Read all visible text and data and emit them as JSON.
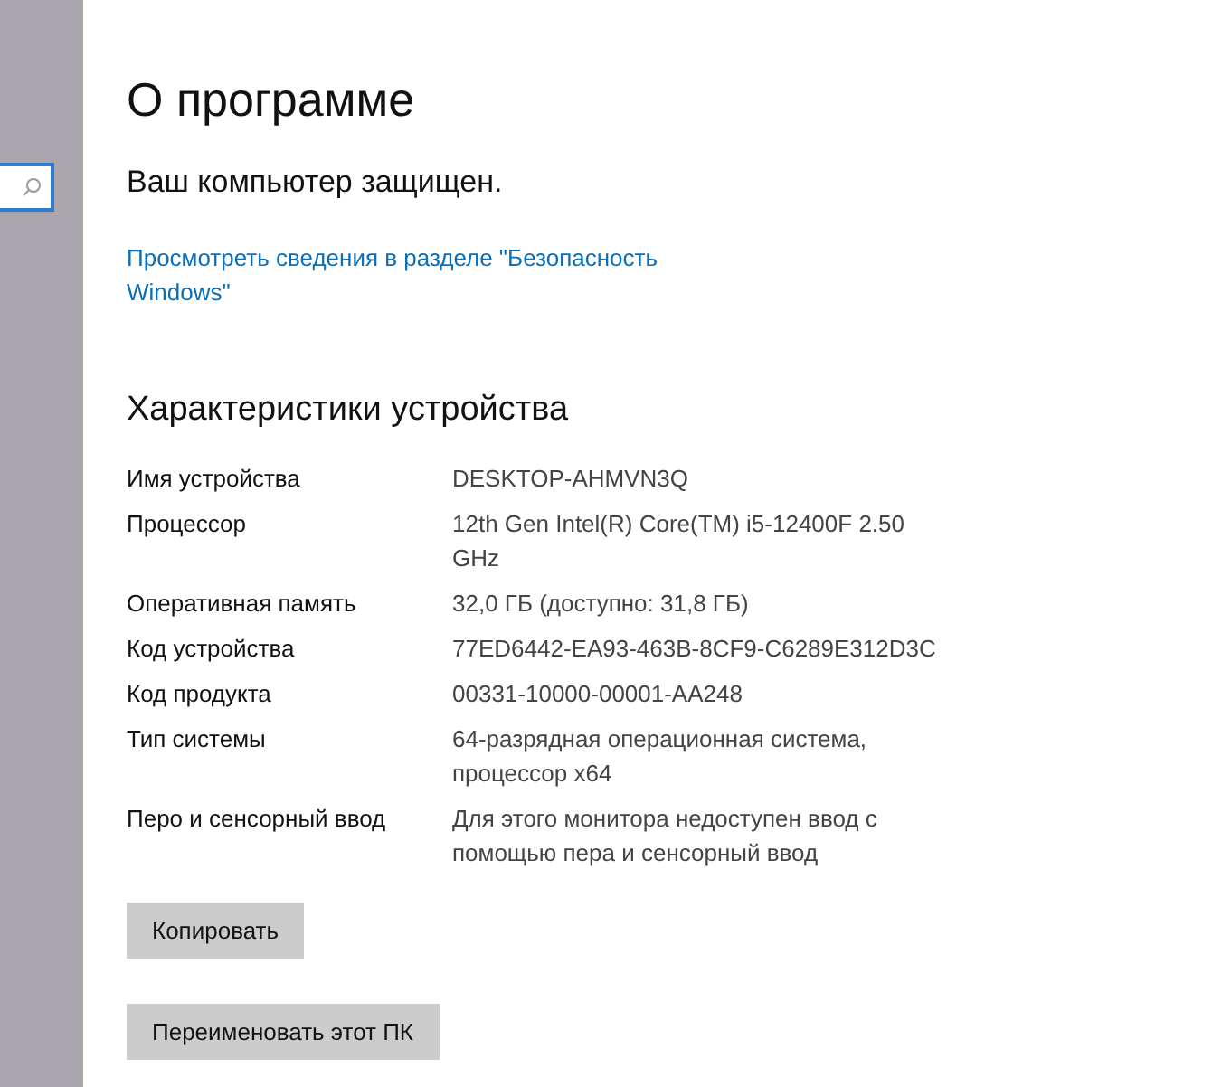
{
  "title": "О программе",
  "security": {
    "status": "Ваш компьютер защищен.",
    "link": "Просмотреть сведения в разделе \"Безопасность Windows\""
  },
  "specs": {
    "heading": "Характеристики устройства",
    "rows": [
      {
        "label": "Имя устройства",
        "value": "DESKTOP-AHMVN3Q"
      },
      {
        "label": "Процессор",
        "value": "12th Gen Intel(R) Core(TM) i5-12400F   2.50 GHz"
      },
      {
        "label": "Оперативная память",
        "value": "32,0 ГБ (доступно: 31,8 ГБ)"
      },
      {
        "label": "Код устройства",
        "value": "77ED6442-EA93-463B-8CF9-C6289E312D3C"
      },
      {
        "label": "Код продукта",
        "value": "00331-10000-00001-AA248"
      },
      {
        "label": "Тип системы",
        "value": "64-разрядная операционная система, процессор x64"
      },
      {
        "label": "Перо и сенсорный ввод",
        "value": "Для этого монитора недоступен ввод с помощью пера и сенсорный ввод"
      }
    ]
  },
  "buttons": [
    "Копировать",
    "Переименовать этот ПК"
  ]
}
